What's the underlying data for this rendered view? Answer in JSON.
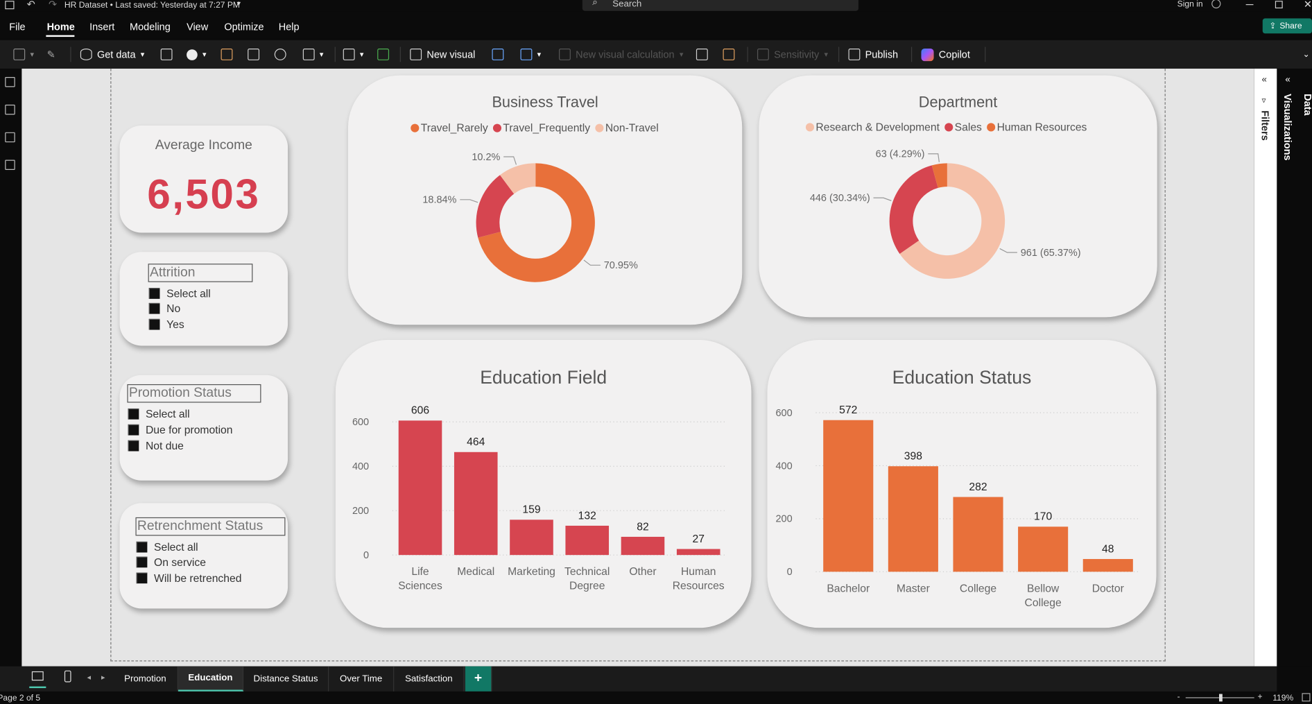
{
  "window": {
    "title": "HR Dataset • Last saved: Yesterday at 7:27 PM",
    "search_placeholder": "Search",
    "sign_in": "Sign in"
  },
  "menu": {
    "items": [
      "File",
      "Home",
      "Insert",
      "Modeling",
      "View",
      "Optimize",
      "Help"
    ],
    "active": "Home",
    "share": "Share"
  },
  "ribbon": {
    "get_data": "Get data",
    "new_visual": "New visual",
    "new_visual_calculation": "New visual calculation",
    "sensitivity": "Sensitivity",
    "publish": "Publish",
    "copilot": "Copilot"
  },
  "kpi": {
    "title": "Average Income",
    "value": "6,503",
    "value_color": "#d63f50"
  },
  "slicers": {
    "attrition": {
      "title": "Attrition",
      "items": [
        "Select all",
        "No",
        "Yes"
      ]
    },
    "promotion": {
      "title": "Promotion Status",
      "items": [
        "Select all",
        "Due for promotion",
        "Not due"
      ]
    },
    "retrenchment": {
      "title": "Retrenchment Status",
      "items": [
        "Select all",
        "On service",
        "Will be retrenched"
      ]
    }
  },
  "chart_data": [
    {
      "type": "pie",
      "title": "Business Travel",
      "donut": true,
      "legend": "top-center",
      "slices": [
        {
          "name": "Travel_Rarely",
          "value": 70.95,
          "label": "70.95%",
          "color": "#e8703a"
        },
        {
          "name": "Travel_Frequently",
          "value": 18.84,
          "label": "18.84%",
          "color": "#d64550"
        },
        {
          "name": "Non-Travel",
          "value": 10.2,
          "label": "10.2%",
          "color": "#f5c0a8"
        }
      ]
    },
    {
      "type": "pie",
      "title": "Department",
      "donut": true,
      "legend": "top-center",
      "slices": [
        {
          "name": "Research & Development",
          "value": 961,
          "label": "961 (65.37%)",
          "color": "#f5c0a8"
        },
        {
          "name": "Sales",
          "value": 446,
          "label": "446 (30.34%)",
          "color": "#d64550"
        },
        {
          "name": "Human Resources",
          "value": 63,
          "label": "63 (4.29%)",
          "color": "#e8703a"
        }
      ]
    },
    {
      "type": "bar",
      "title": "Education Field",
      "categories": [
        "Life Sciences",
        "Medical",
        "Marketing",
        "Technical Degree",
        "Other",
        "Human Resources"
      ],
      "values": [
        606,
        464,
        159,
        132,
        82,
        27
      ],
      "ylim": [
        0,
        600
      ],
      "yticks": [
        0,
        200,
        400,
        600
      ],
      "color": "#d64550",
      "grid": true
    },
    {
      "type": "bar",
      "title": "Education Status",
      "categories": [
        "Bachelor",
        "Master",
        "College",
        "Bellow College",
        "Doctor"
      ],
      "values": [
        572,
        398,
        282,
        170,
        48
      ],
      "ylim": [
        0,
        600
      ],
      "yticks": [
        0,
        200,
        400,
        600
      ],
      "color": "#e8703a",
      "grid": true
    }
  ],
  "panes": {
    "filters": "Filters",
    "visualizations": "Visualizations",
    "data": "Data"
  },
  "tabs": {
    "items": [
      "Promotion",
      "Education",
      "Distance Status",
      "Over Time",
      "Satisfaction"
    ],
    "active": "Education",
    "add": "+"
  },
  "status": {
    "page": "Page 2 of 5",
    "zoom": "119%",
    "minus": "-",
    "plus": "+"
  }
}
